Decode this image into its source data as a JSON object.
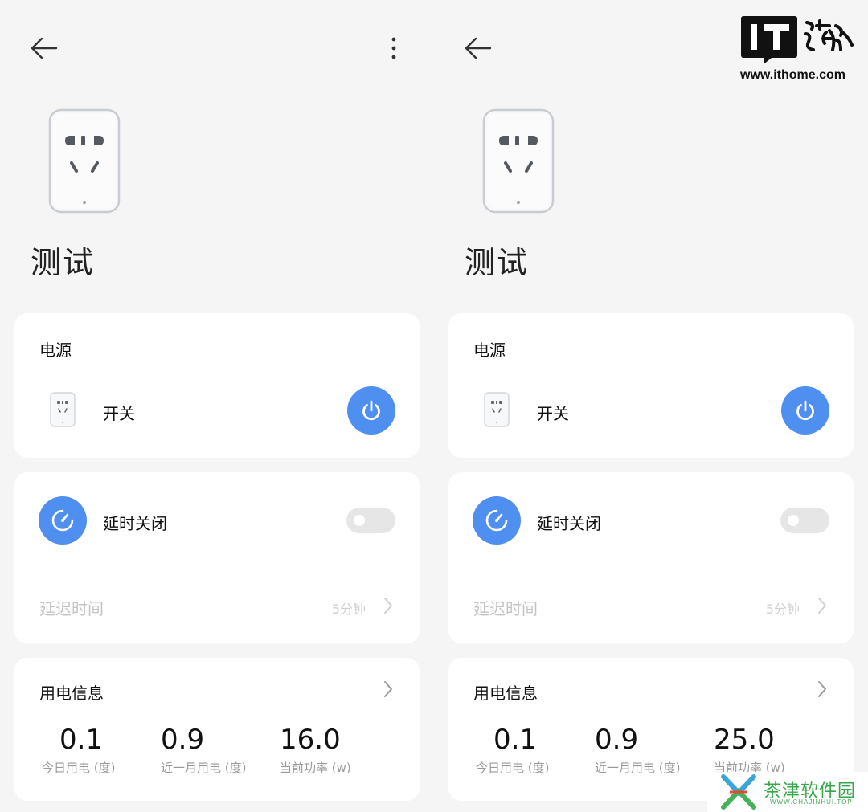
{
  "screens": [
    {
      "device_name": "测试",
      "power_card": {
        "title": "电源",
        "switch_label": "开关",
        "power_on": true
      },
      "delay_card": {
        "title": "延时关闭",
        "enabled": false,
        "delay_label": "延迟时间",
        "delay_value": "5分钟"
      },
      "usage_card": {
        "title": "用电信息",
        "stats": [
          {
            "value": "0.1",
            "label": "今日用电 (度)"
          },
          {
            "value": "0.9",
            "label": "近一月用电 (度)"
          },
          {
            "value": "16.0",
            "label": "当前功率 (w)"
          }
        ]
      }
    },
    {
      "device_name": "测试",
      "power_card": {
        "title": "电源",
        "switch_label": "开关",
        "power_on": true
      },
      "delay_card": {
        "title": "延时关闭",
        "enabled": false,
        "delay_label": "延迟时间",
        "delay_value": "5分钟"
      },
      "usage_card": {
        "title": "用电信息",
        "stats": [
          {
            "value": "0.1",
            "label": "今日用电 (度)"
          },
          {
            "value": "0.9",
            "label": "近一月用电 (度)"
          },
          {
            "value": "25.0",
            "label": "当前功率 (w)"
          }
        ]
      }
    }
  ],
  "watermarks": {
    "ithome_url": "www.ithome.com",
    "site_name": "茶津软件园",
    "site_url": "WWW.CHAJINHUI.TOP"
  },
  "icons": {
    "back": "arrow-left-icon",
    "more": "more-vertical-icon",
    "power": "power-icon",
    "timer": "timer-icon",
    "chevron": "chevron-right-icon"
  },
  "colors": {
    "accent": "#4f8ff0",
    "background": "#f5f5f5",
    "card": "#ffffff",
    "muted_text": "#9a9a9a"
  }
}
